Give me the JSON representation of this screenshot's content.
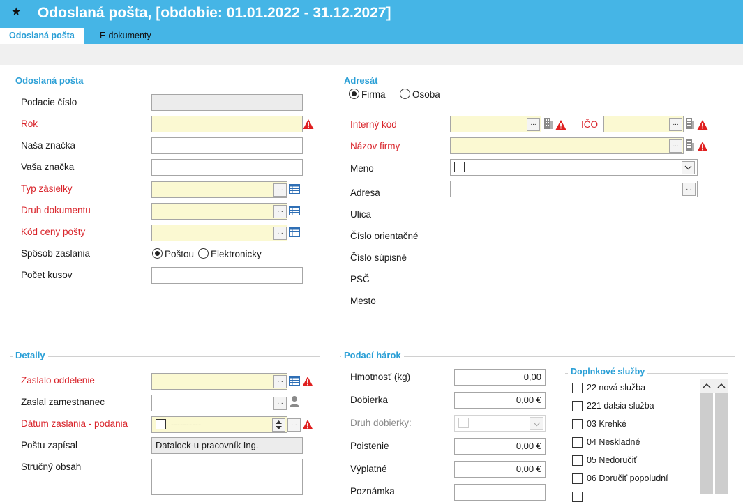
{
  "window": {
    "star_icon": "star-icon",
    "title": "Odoslaná pošta, [obdobie: 01.01.2022 - 31.12.2027]"
  },
  "tabs": [
    {
      "label": "Odoslaná pošta",
      "active": true
    },
    {
      "label": "E-dokumenty",
      "active": false
    }
  ],
  "colors": {
    "titlebar": "#45b5e6",
    "accent": "#2a9fd6",
    "required": "#d9242b",
    "required_field_bg": "#fbf9d2",
    "warning": "#e02020"
  },
  "odoslana": {
    "section": "Odoslaná pošta",
    "podacie_cislo": {
      "label": "Podacie číslo",
      "value": ""
    },
    "rok": {
      "label": "Rok",
      "value": ""
    },
    "nasa_znacka": {
      "label": "Naša značka",
      "value": ""
    },
    "vasa_znacka": {
      "label": "Vaša značka",
      "value": ""
    },
    "typ_zasielky": {
      "label": "Typ zásielky",
      "value": ""
    },
    "druh_dokumentu": {
      "label": "Druh dokumentu",
      "value": ""
    },
    "kod_ceny": {
      "label": "Kód ceny pošty",
      "value": ""
    },
    "sposob": {
      "label": "Spôsob zaslania",
      "options": [
        "Poštou",
        "Elektronicky"
      ],
      "selected": "Poštou"
    },
    "pocet_kusov": {
      "label": "Počet kusov",
      "value": ""
    }
  },
  "adresat": {
    "section": "Adresát",
    "type_options": [
      "Firma",
      "Osoba"
    ],
    "type_selected": "Firma",
    "interny_kod": {
      "label": "Interný kód",
      "value": ""
    },
    "ico": {
      "label": "IČO",
      "value": ""
    },
    "nazov_firmy": {
      "label": "Názov firmy",
      "value": ""
    },
    "meno": {
      "label": "Meno",
      "value": ""
    },
    "adresa": {
      "label": "Adresa",
      "value": ""
    },
    "ulica": {
      "label": "Ulica"
    },
    "cislo_orientacne": {
      "label": "Číslo orientačné"
    },
    "cislo_supisne": {
      "label": "Číslo súpisné"
    },
    "psc": {
      "label": "PSČ"
    },
    "mesto": {
      "label": "Mesto"
    }
  },
  "detaily": {
    "section": "Detaily",
    "zaslalo_oddelenie": {
      "label": "Zaslalo oddelenie",
      "value": ""
    },
    "zaslal_zamestnanec": {
      "label": "Zaslal zamestnanec",
      "value": ""
    },
    "datum_zaslania": {
      "label": "Dátum zaslania - podania",
      "value": "----------",
      "checked": false
    },
    "postu_zapisal": {
      "label": "Poštu zapísal",
      "value": "Datalock-u pracovník Ing."
    },
    "strucny_obsah": {
      "label": "Stručný obsah",
      "value": ""
    }
  },
  "podaci": {
    "section": "Podací hárok",
    "hmotnost": {
      "label": "Hmotnosť (kg)",
      "value": "0,00"
    },
    "dobierka": {
      "label": "Dobierka",
      "value": "0,00 €"
    },
    "druh_dobierky": {
      "label": "Druh dobierky:",
      "value": ""
    },
    "poistenie": {
      "label": "Poistenie",
      "value": "0,00 €"
    },
    "vyplatne": {
      "label": "Výplatné",
      "value": "0,00 €"
    },
    "poznamka": {
      "label": "Poznámka",
      "value": ""
    }
  },
  "doplnkove": {
    "section": "Doplnkové služby",
    "items": [
      {
        "label": "22 nová služba",
        "checked": false
      },
      {
        "label": "221 dalsia služba",
        "checked": false
      },
      {
        "label": "03 Krehké",
        "checked": false
      },
      {
        "label": "04 Neskladné",
        "checked": false
      },
      {
        "label": "05 Nedoručiť",
        "checked": false
      },
      {
        "label": "06 Doručiť popoludní",
        "checked": false
      }
    ]
  }
}
